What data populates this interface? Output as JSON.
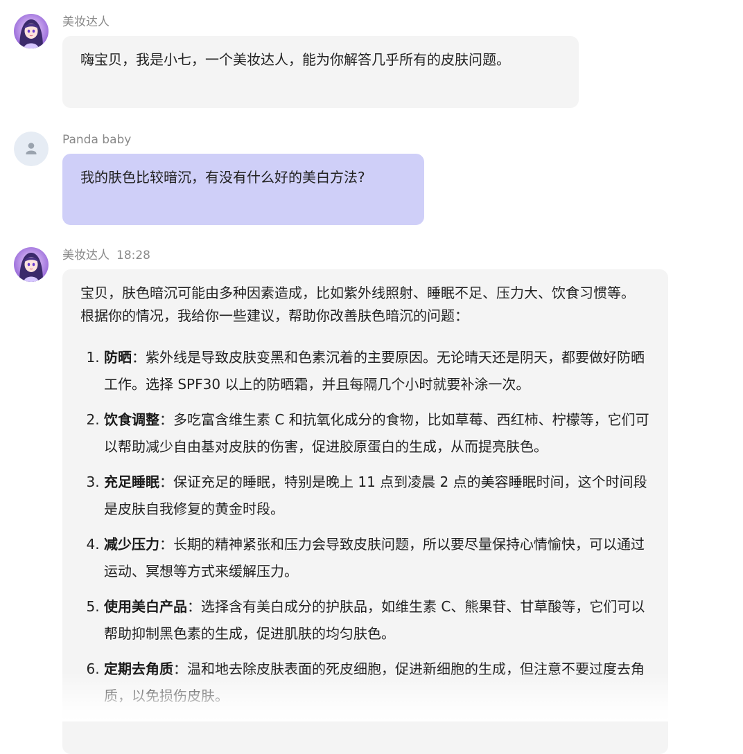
{
  "messages": [
    {
      "sender": "美妆达人",
      "time": "",
      "text": "嗨宝贝，我是小七，一个美妆达人，能为你解答几乎所有的皮肤问题。"
    },
    {
      "sender": "Panda baby",
      "time": "",
      "text": "我的肤色比较暗沉，有没有什么好的美白方法?"
    },
    {
      "sender": "美妆达人",
      "time": "18:28",
      "intro": "宝贝，肤色暗沉可能由多种因素造成，比如紫外线照射、睡眠不足、压力大、饮食习惯等。根据你的情况，我给你一些建议，帮助你改善肤色暗沉的问题：",
      "tips": [
        {
          "title": "防晒",
          "text": "：紫外线是导致皮肤变黑和色素沉着的主要原因。无论晴天还是阴天，都要做好防晒工作。选择 SPF30 以上的防晒霜，并且每隔几个小时就要补涂一次。"
        },
        {
          "title": "饮食调整",
          "text": "：多吃富含维生素 C 和抗氧化成分的食物，比如草莓、西红柿、柠檬等，它们可以帮助减少自由基对皮肤的伤害，促进胶原蛋白的生成，从而提亮肤色。"
        },
        {
          "title": "充足睡眠",
          "text": "：保证充足的睡眠，特别是晚上 11 点到凌晨 2 点的美容睡眠时间，这个时间段是皮肤自我修复的黄金时段。"
        },
        {
          "title": "减少压力",
          "text": "：长期的精神紧张和压力会导致皮肤问题，所以要尽量保持心情愉快，可以通过运动、冥想等方式来缓解压力。"
        },
        {
          "title": "使用美白产品",
          "text": "：选择含有美白成分的护肤品，如维生素 C、熊果苷、甘草酸等，它们可以帮助抑制黑色素的生成，促进肌肤的均匀肤色。"
        },
        {
          "title": "定期去角质",
          "text": "：温和地去除皮肤表面的死皮细胞，促进新细胞的生成，但注意不要过度去角质，以免损伤皮肤。"
        }
      ]
    }
  ],
  "colors": {
    "bot_bubble": "#f4f4f4",
    "user_bubble": "#cfcff8",
    "meta_text": "#8a8a8a"
  },
  "icons": {
    "bot_avatar": "anime-girl-avatar",
    "user_avatar": "default-person-icon"
  }
}
